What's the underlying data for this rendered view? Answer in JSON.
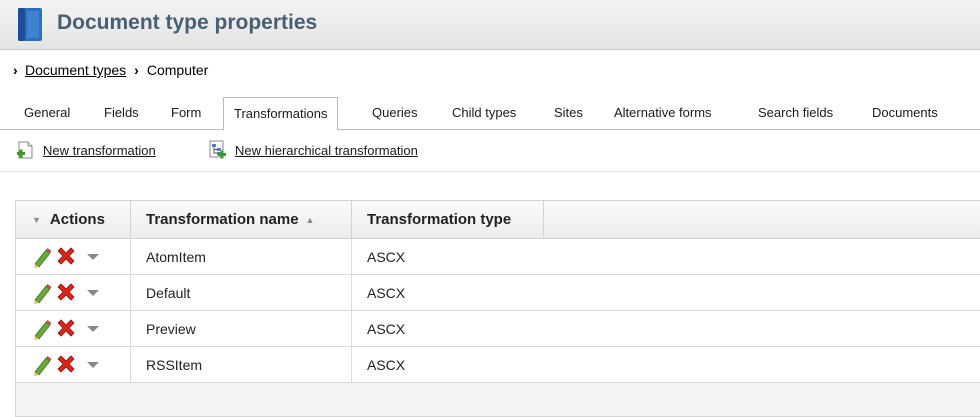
{
  "header": {
    "title": "Document type properties",
    "icon": "document-type-icon"
  },
  "breadcrumb": {
    "parent_label": "Document types",
    "current_label": "Computer"
  },
  "tabs": [
    {
      "label": "General"
    },
    {
      "label": "Fields"
    },
    {
      "label": "Form"
    },
    {
      "label": "Transformations",
      "active": true
    },
    {
      "label": "Queries"
    },
    {
      "label": "Child types"
    },
    {
      "label": "Sites"
    },
    {
      "label": "Alternative forms"
    },
    {
      "label": "Search fields"
    },
    {
      "label": "Documents"
    }
  ],
  "toolbar": {
    "new_transformation_label": "New transformation",
    "new_hierarchical_label": "New hierarchical transformation"
  },
  "grid": {
    "columns": {
      "actions": "Actions",
      "name": "Transformation name",
      "type": "Transformation type"
    },
    "sort_column": "Transformation name",
    "sort_direction": "ascending",
    "rows": [
      {
        "name": "AtomItem",
        "type": "ASCX"
      },
      {
        "name": "Default",
        "type": "ASCX"
      },
      {
        "name": "Preview",
        "type": "ASCX"
      },
      {
        "name": "RSSItem",
        "type": "ASCX"
      }
    ]
  },
  "colors": {
    "title": "#4b5f72",
    "delete_red": "#d8261c",
    "edit_green": "#6aa83a",
    "header_icon_blue": "#2d6fbf"
  }
}
